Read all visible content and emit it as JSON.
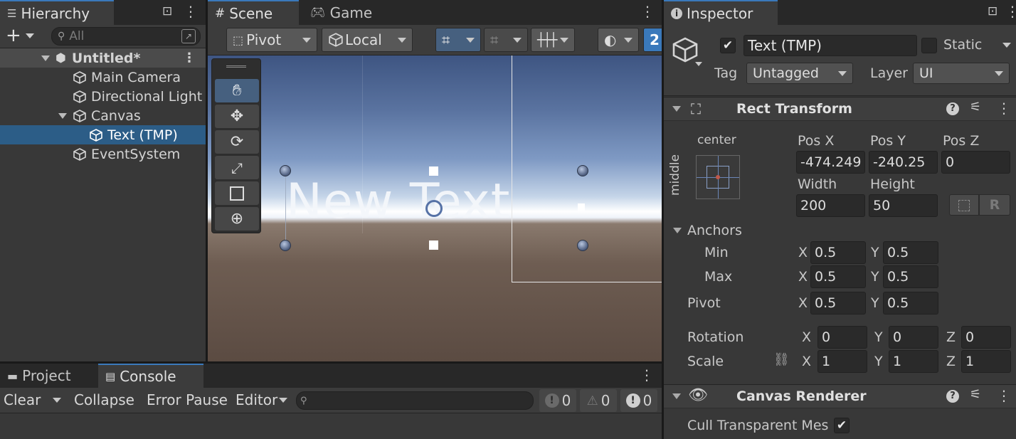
{
  "hierarchy": {
    "tab_label": "Hierarchy",
    "search_placeholder": "All",
    "scene_name": "Untitled*",
    "items": [
      "Main Camera",
      "Directional Light",
      "Canvas",
      "Text (TMP)",
      "EventSystem"
    ]
  },
  "scene_view": {
    "tabs": [
      "Scene",
      "Game"
    ],
    "pivot_label": "Pivot",
    "local_label": "Local",
    "overflow_label": "2",
    "canvas_text": "New Text"
  },
  "bottom_panel": {
    "tabs": [
      "Project",
      "Console"
    ],
    "clear_label": "Clear",
    "collapse_label": "Collapse",
    "error_pause_label": "Error Pause",
    "editor_label": "Editor",
    "log_count": "0",
    "warn_count": "0",
    "error_count": "0"
  },
  "inspector": {
    "tab_label": "Inspector",
    "object_name": "Text (TMP)",
    "active": true,
    "static_label": "Static",
    "tag_label": "Tag",
    "tag_value": "Untagged",
    "layer_label": "Layer",
    "layer_value": "UI",
    "rect_transform": {
      "title": "Rect Transform",
      "anchor_h": "center",
      "anchor_v": "middle",
      "pos_x_label": "Pos X",
      "pos_y_label": "Pos Y",
      "pos_z_label": "Pos Z",
      "pos_x": "-474.249",
      "pos_y": "-240.25",
      "pos_z": "0",
      "width_label": "Width",
      "height_label": "Height",
      "width": "200",
      "height": "50",
      "r_label": "R",
      "anchors_label": "Anchors",
      "min_label": "Min",
      "max_label": "Max",
      "pivot_label": "Pivot",
      "x_label": "X",
      "y_label": "Y",
      "z_label": "Z",
      "min_x": "0.5",
      "min_y": "0.5",
      "max_x": "0.5",
      "max_y": "0.5",
      "pivot_x": "0.5",
      "pivot_y": "0.5",
      "rotation_label": "Rotation",
      "rot_x": "0",
      "rot_y": "0",
      "rot_z": "0",
      "scale_label": "Scale",
      "scale_x": "1",
      "scale_y": "1",
      "scale_z": "1"
    },
    "canvas_renderer": {
      "title": "Canvas Renderer",
      "cull_label": "Cull Transparent Mes",
      "cull_checked": true
    }
  },
  "colors": {
    "selection": "#2c5d87",
    "accent": "#3a79bb",
    "panel": "#383838",
    "field": "#2a2a2a"
  }
}
